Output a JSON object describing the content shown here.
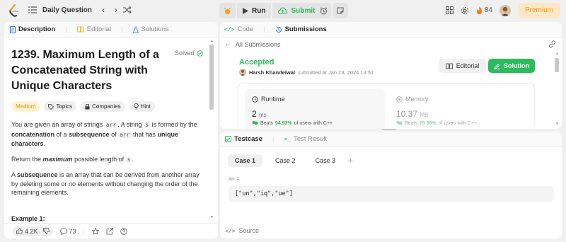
{
  "topbar": {
    "problem_list_label": "Daily Question",
    "run_label": "Run",
    "submit_label": "Submit",
    "streak_count": "84",
    "premium_label": "Premium"
  },
  "description_panel": {
    "tabs": [
      "Description",
      "Editorial",
      "Solutions"
    ],
    "title": "1239. Maximum Length of a Concatenated String with Unique Characters",
    "solved_label": "Solved",
    "chips": [
      "Medium",
      "Topics",
      "Companies",
      "Hint"
    ],
    "p1_a": "You are given an array of strings ",
    "p1_code1": "arr",
    "p1_b": ". A string ",
    "p1_code2": "s",
    "p1_c": " is formed by the ",
    "p1_bold1": "concatenation",
    "p1_d": " of a ",
    "p1_bold2": "subsequence",
    "p1_e": " of ",
    "p1_code3": "arr",
    "p1_f": " that has ",
    "p1_bold3": "unique characters",
    "p1_g": ".",
    "p2_a": "Return the ",
    "p2_bold": "maximum",
    "p2_b": " possible length of ",
    "p2_code": "s",
    "p2_c": ".",
    "p3_a": "A ",
    "p3_bold": "subsequence",
    "p3_b": " is an array that can be derived from another array by deleting some or no elements without changing the order of the remaining elements.",
    "example_heading": "Example 1:",
    "likes": "4.2K",
    "comments": "73"
  },
  "submission_panel": {
    "tabs": [
      "Code",
      "Submissions"
    ],
    "back_label": "All Submissions",
    "status": "Accepted",
    "author": "Harsh Khandelwal",
    "submitted_text": "submitted at Jan 23, 2024 13:51",
    "editorial_button": "Editorial",
    "solution_button": "Solution",
    "runtime_label": "Runtime",
    "runtime_value": "2",
    "runtime_unit": "ms",
    "runtime_beats_prefix": "Beats",
    "runtime_beats_pct": "94.93%",
    "runtime_beats_suffix": "of users with C++",
    "memory_label": "Memory",
    "memory_value": "10.37",
    "memory_unit": "MB",
    "memory_beats_prefix": "Beats",
    "memory_beats_pct": "70.59%",
    "memory_beats_suffix": "of users with C++"
  },
  "testcase_panel": {
    "tabs": [
      "Testcase",
      "Test Result"
    ],
    "cases": [
      "Case 1",
      "Case 2",
      "Case 3"
    ],
    "add_label": "+",
    "input_label": "arr =",
    "input_value": "[\"un\",\"iq\",\"ue\"]",
    "source_label": "Source"
  },
  "colors": {
    "accent_green": "#2cbb5d",
    "medium": "#d99a0b",
    "streak": "#f97316"
  }
}
